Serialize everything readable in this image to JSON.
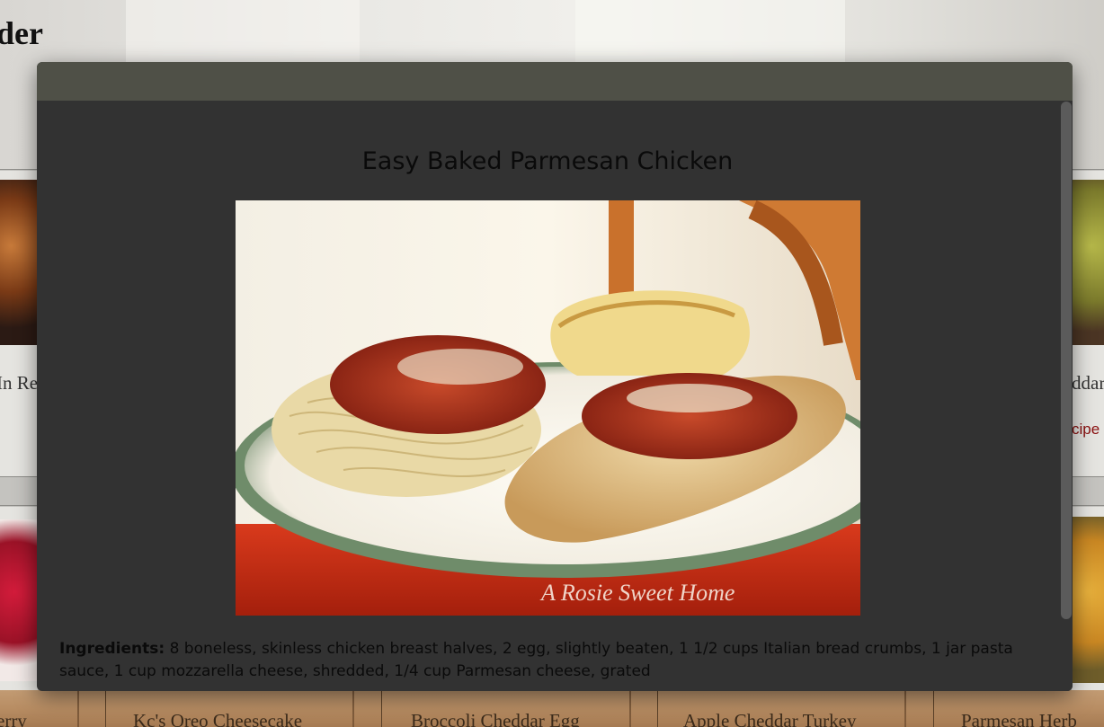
{
  "page": {
    "title_fragment": "der"
  },
  "background_cards": {
    "left_titles": [
      "In Re",
      "erry"
    ],
    "right_title": "ddar",
    "right_link": "cipe",
    "bottom_titles": [
      "Kc's Oreo Cheesecake",
      "Broccoli Cheddar Egg",
      "Apple Cheddar Turkey",
      "Parmesan Herb"
    ]
  },
  "modal": {
    "title": "Easy Baked Parmesan Chicken",
    "image_alt": "Baked parmesan chicken with spaghetti and bread",
    "watermark": "A Rosie Sweet Home",
    "ingredients_label": "Ingredients:",
    "ingredients_text": " 8 boneless, skinless chicken breast halves, 2 egg, slightly beaten, 1 1/2 cups Italian bread crumbs, 1 jar pasta sauce, 1 cup mozzarella cheese, shredded, 1/4 cup Parmesan cheese, grated"
  },
  "colors": {
    "modal_bg": "#323232",
    "modal_header": "#4f5047",
    "link": "#8a0f0f"
  }
}
